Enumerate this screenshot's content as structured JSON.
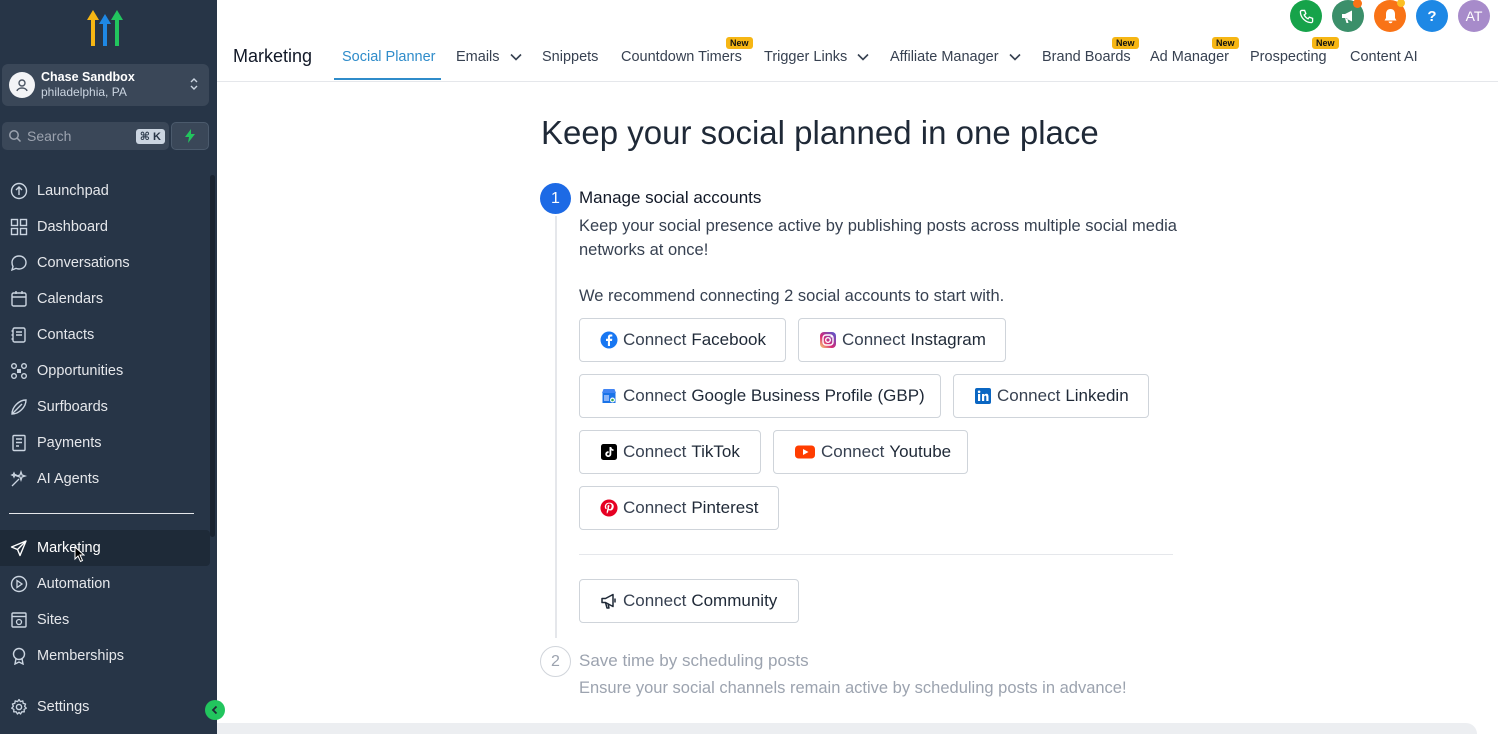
{
  "sidebar": {
    "account": {
      "name": "Chase Sandbox",
      "location": "philadelphia, PA"
    },
    "search": {
      "placeholder": "Search",
      "shortcut": "⌘ K"
    },
    "items": [
      {
        "label": "Launchpad",
        "icon": "launchpad-icon"
      },
      {
        "label": "Dashboard",
        "icon": "dashboard-icon"
      },
      {
        "label": "Conversations",
        "icon": "chat-icon"
      },
      {
        "label": "Calendars",
        "icon": "calendar-icon"
      },
      {
        "label": "Contacts",
        "icon": "contacts-icon"
      },
      {
        "label": "Opportunities",
        "icon": "opportunities-icon"
      },
      {
        "label": "Surfboards",
        "icon": "surfboard-icon"
      },
      {
        "label": "Payments",
        "icon": "payments-icon"
      },
      {
        "label": "AI Agents",
        "icon": "ai-agents-icon"
      }
    ],
    "bottom_items": [
      {
        "label": "Marketing",
        "icon": "send-icon",
        "active": true
      },
      {
        "label": "Automation",
        "icon": "automation-icon"
      },
      {
        "label": "Sites",
        "icon": "sites-icon"
      },
      {
        "label": "Memberships",
        "icon": "memberships-icon"
      }
    ],
    "settings": {
      "label": "Settings",
      "icon": "gear-icon"
    }
  },
  "header": {
    "title": "Marketing",
    "tabs": [
      {
        "label": "Social Planner",
        "active": true
      },
      {
        "label": "Emails",
        "dropdown": true
      },
      {
        "label": "Snippets"
      },
      {
        "label": "Countdown Timers",
        "badge": "New"
      },
      {
        "label": "Trigger Links",
        "dropdown": true
      },
      {
        "label": "Affiliate Manager",
        "dropdown": true
      },
      {
        "label": "Brand Boards",
        "badge": "New"
      },
      {
        "label": "Ad Manager",
        "badge": "New"
      },
      {
        "label": "Prospecting",
        "badge": "New"
      },
      {
        "label": "Content AI"
      }
    ],
    "user_initials": "AT",
    "help_symbol": "?"
  },
  "main": {
    "title": "Keep your social planned in one place",
    "step1": {
      "number": "1",
      "title": "Manage social accounts",
      "description": "Keep your social presence active by publishing posts across multiple social media networks at once!",
      "recommendation": "We recommend connecting 2 social accounts to start with.",
      "connect_prefix": "Connect",
      "networks": [
        {
          "name": "Facebook",
          "icon": "facebook-icon",
          "color": "#1877f2"
        },
        {
          "name": "Instagram",
          "icon": "instagram-icon",
          "color": "#d62976"
        },
        {
          "name": "Google Business Profile (GBP)",
          "icon": "google-business-icon",
          "color": "#4285f4"
        },
        {
          "name": "Linkedin",
          "icon": "linkedin-icon",
          "color": "#0a66c2"
        },
        {
          "name": "TikTok",
          "icon": "tiktok-icon",
          "color": "#000000"
        },
        {
          "name": "Youtube",
          "icon": "youtube-icon",
          "color": "#ff0000"
        },
        {
          "name": "Pinterest",
          "icon": "pinterest-icon",
          "color": "#e60023"
        }
      ],
      "community": {
        "name": "Community",
        "icon": "megaphone-icon"
      }
    },
    "step2": {
      "number": "2",
      "title": "Save time by scheduling posts",
      "description": "Ensure your social channels remain active by scheduling posts in advance!"
    }
  },
  "colors": {
    "sidebar_bg": "#273547",
    "accent": "#2f8cca",
    "step_active": "#1d6ae5",
    "badge": "#f6b614",
    "phone": "#16a34a",
    "megaphone": "#3b8f6a",
    "bell": "#f97316",
    "help": "#1e88e5",
    "avatar": "#a78bca"
  }
}
